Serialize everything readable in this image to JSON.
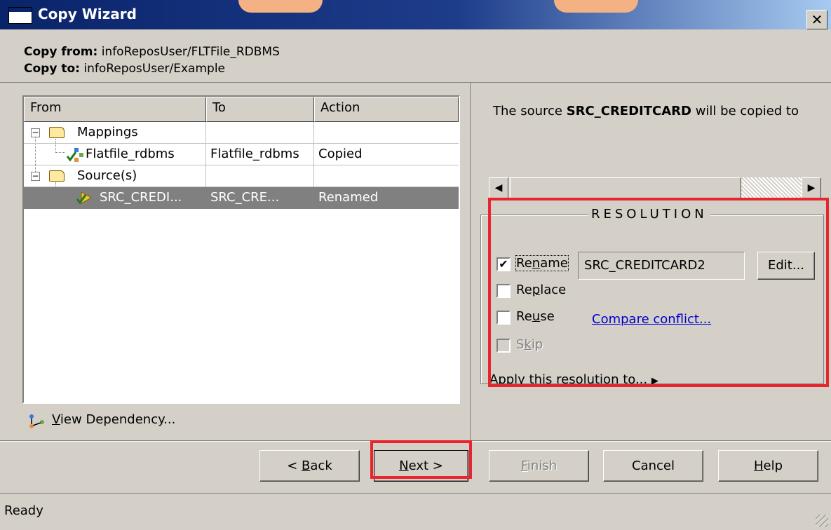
{
  "window": {
    "title": "Copy Wizard",
    "close_glyph": "✕"
  },
  "header": {
    "copy_from_label": "Copy from:",
    "copy_from_value": "infoReposUser/FLTFile_RDBMS",
    "copy_to_label": "Copy to:",
    "copy_to_value": "infoReposUser/Example"
  },
  "grid": {
    "columns": [
      "From",
      "To",
      "Action"
    ],
    "rows": [
      {
        "from": "Mappings",
        "to": "",
        "action": "",
        "type": "folder"
      },
      {
        "from": "Flatfile_rdbms",
        "to": "Flatfile_rdbms",
        "action": "Copied",
        "type": "mapping"
      },
      {
        "from": "Source(s)",
        "to": "",
        "action": "",
        "type": "folder"
      },
      {
        "from": "SRC_CREDI...",
        "to": "SRC_CRE...",
        "action": "Renamed",
        "type": "source",
        "selected": true
      }
    ]
  },
  "view_dependency": {
    "label_pre": "",
    "label_u": "V",
    "label_post": "iew Dependency..."
  },
  "right": {
    "message_pre": "The source ",
    "message_bold": "SRC_CREDITCARD",
    "message_post": " will be copied to"
  },
  "resolution": {
    "title": "RESOLUTION",
    "rename": {
      "pre": "Re",
      "u": "n",
      "post": "ame",
      "checked": true,
      "check_glyph": "✔"
    },
    "rename_value": "SRC_CREDITCARD2",
    "edit_label": "Edit...",
    "replace": {
      "pre": "Re",
      "u": "p",
      "post": "lace"
    },
    "reuse": {
      "pre": "Re",
      "u": "u",
      "post": "se"
    },
    "skip": {
      "pre": "S",
      "u": "k",
      "post": "ip"
    },
    "compare_link": "Compare conflict...",
    "apply_pre": "Apply this re",
    "apply_u": "s",
    "apply_post": "olution to...",
    "apply_arrow": "▶"
  },
  "buttons": {
    "back": {
      "pre": "< ",
      "u": "B",
      "post": "ack"
    },
    "next": {
      "pre": "",
      "u": "N",
      "post": "ext >"
    },
    "finish": {
      "pre": "",
      "u": "F",
      "post": "inish"
    },
    "cancel": "Cancel",
    "help": {
      "pre": "",
      "u": "H",
      "post": "elp"
    }
  },
  "status": "Ready",
  "scroll": {
    "left": "◀",
    "right": "▶"
  },
  "tree_glyphs": {
    "minus": "−"
  },
  "colors": {
    "highlight": "#e8252d",
    "title_bar": "#0a246a",
    "link": "#0000cc"
  }
}
